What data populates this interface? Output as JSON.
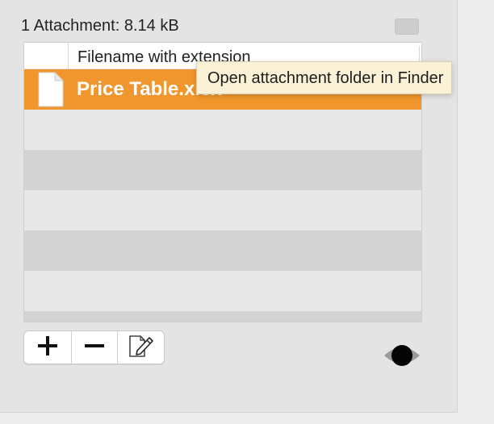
{
  "attachments": {
    "summary": "1 Attachment: 8.14 kB",
    "column_header": "Filename with extension",
    "files": [
      {
        "name": "Price Table.xlsx",
        "icon": "document-icon",
        "selected": true
      }
    ]
  },
  "tooltip": {
    "text": "Open attachment folder in Finder"
  },
  "toolbar": {
    "add_icon": "plus-icon",
    "remove_icon": "minus-icon",
    "edit_icon": "edit-document-icon"
  },
  "preview": {
    "icon": "eye-icon"
  },
  "colors": {
    "selection": "#f0962c",
    "tooltip_background": "#fbf1d6"
  }
}
